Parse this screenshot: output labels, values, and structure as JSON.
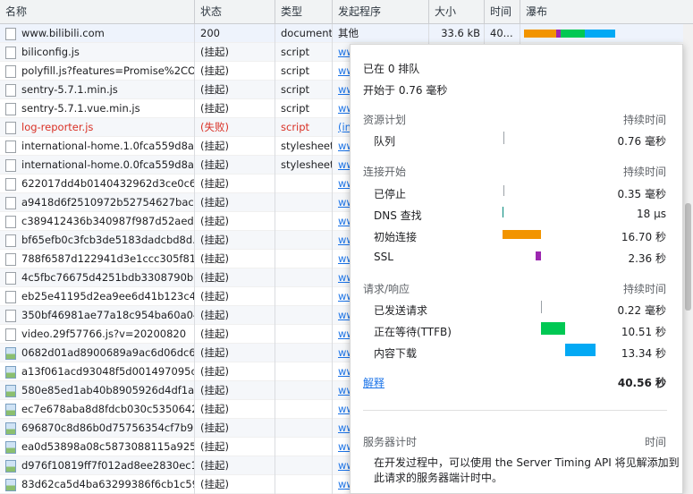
{
  "headers": {
    "name": "名称",
    "status": "状态",
    "type": "类型",
    "initiator": "发起程序",
    "size": "大小",
    "time": "时间",
    "waterfall": "瀑布"
  },
  "rows": [
    {
      "name": "www.bilibili.com",
      "status": "200",
      "type": "document",
      "initiator": "其他",
      "size": "33.6 kB",
      "time": "40...",
      "icon": "file"
    },
    {
      "name": "biliconfig.js",
      "status": "(挂起)",
      "type": "script",
      "initiator": "ww",
      "icon": "file"
    },
    {
      "name": "polyfill.js?features=Promise%2CO...",
      "status": "(挂起)",
      "type": "script",
      "initiator": "ww",
      "icon": "file"
    },
    {
      "name": "sentry-5.7.1.min.js",
      "status": "(挂起)",
      "type": "script",
      "initiator": "ww",
      "icon": "file"
    },
    {
      "name": "sentry-5.7.1.vue.min.js",
      "status": "(挂起)",
      "type": "script",
      "initiator": "ww",
      "icon": "file"
    },
    {
      "name": "log-reporter.js",
      "status": "(失败)",
      "type": "script",
      "initiator": "(in",
      "icon": "file",
      "failed": true
    },
    {
      "name": "international-home.1.0fca559d8a...",
      "status": "(挂起)",
      "type": "stylesheet",
      "initiator": "ww",
      "icon": "file"
    },
    {
      "name": "international-home.0.0fca559d8a...",
      "status": "(挂起)",
      "type": "stylesheet",
      "initiator": "ww",
      "icon": "file"
    },
    {
      "name": "622017dd4b0140432962d3ce0c6...",
      "status": "(挂起)",
      "type": "",
      "initiator": "ww",
      "icon": "file"
    },
    {
      "name": "a9418d6f2510972b52754627bac9...",
      "status": "(挂起)",
      "type": "",
      "initiator": "ww",
      "icon": "file"
    },
    {
      "name": "c389412436b340987f987d52aed9...",
      "status": "(挂起)",
      "type": "",
      "initiator": "ww",
      "icon": "file"
    },
    {
      "name": "bf65efb0c3fcb3de5183dadcbd8d...",
      "status": "(挂起)",
      "type": "",
      "initiator": "ww",
      "icon": "file"
    },
    {
      "name": "788f6587d122941d3e1ccc305f81...",
      "status": "(挂起)",
      "type": "",
      "initiator": "ww",
      "icon": "file"
    },
    {
      "name": "4c5fbc76675d4251bdb3308790b...",
      "status": "(挂起)",
      "type": "",
      "initiator": "ww",
      "icon": "file"
    },
    {
      "name": "eb25e41195d2ea9ee6d41b123c4...",
      "status": "(挂起)",
      "type": "",
      "initiator": "ww",
      "icon": "file"
    },
    {
      "name": "350bf46981ae77a18c954ba60a04...",
      "status": "(挂起)",
      "type": "",
      "initiator": "ww",
      "icon": "file"
    },
    {
      "name": "video.29f57766.js?v=20200820",
      "status": "(挂起)",
      "type": "",
      "initiator": "ww",
      "icon": "file"
    },
    {
      "name": "0682d01ad8900689a9ac6d06dc6...",
      "status": "(挂起)",
      "type": "",
      "initiator": "ww",
      "icon": "img"
    },
    {
      "name": "a13f061acd93048f5d001497095c...",
      "status": "(挂起)",
      "type": "",
      "initiator": "ww",
      "icon": "img"
    },
    {
      "name": "580e85ed1ab40b8905926d4df1a...",
      "status": "(挂起)",
      "type": "",
      "initiator": "ww",
      "icon": "img"
    },
    {
      "name": "ec7e678aba8d8fdcb030c5350642...",
      "status": "(挂起)",
      "type": "",
      "initiator": "ww",
      "icon": "img"
    },
    {
      "name": "696870c8d86b0d75756354cf7b9...",
      "status": "(挂起)",
      "type": "",
      "initiator": "ww",
      "icon": "img"
    },
    {
      "name": "ea0d53898a08c5873088115a925...",
      "status": "(挂起)",
      "type": "",
      "initiator": "ww",
      "icon": "img"
    },
    {
      "name": "d976f10819ff7f012ad8ee2830ec1...",
      "status": "(挂起)",
      "type": "",
      "initiator": "ww",
      "icon": "img"
    },
    {
      "name": "83d62ca5d4ba63299386f6cb1c59...",
      "status": "(挂起)",
      "type": "",
      "initiator": "ww",
      "icon": "img"
    }
  ],
  "popover": {
    "queued_at": "已在 0 排队",
    "started_at": "开始于 0.76 毫秒",
    "resource_scheduling": "资源计划",
    "duration": "持续时间",
    "queueing": "队列",
    "queueing_val": "0.76 毫秒",
    "connection_start": "连接开始",
    "stalled": "已停止",
    "stalled_val": "0.35 毫秒",
    "dns": "DNS 查找",
    "dns_val": "18 µs",
    "initial_connection": "初始连接",
    "initial_connection_val": "16.70 秒",
    "ssl": "SSL",
    "ssl_val": "2.36 秒",
    "request_response": "请求/响应",
    "request_sent": "已发送请求",
    "request_sent_val": "0.22 毫秒",
    "waiting": "正在等待(TTFB)",
    "waiting_val": "10.51 秒",
    "content_download": "内容下载",
    "content_download_val": "13.34 秒",
    "explanation": "解释",
    "total": "40.56 秒",
    "server_timing": "服务器计时",
    "time": "时间",
    "server_note_1": "在开发过程中，可以使用 the Server Timing API 将见解添加到",
    "server_note_2": "此请求的服务器端计时中。"
  },
  "colors": {
    "connection": "#f29400",
    "ssl": "#9c27b0",
    "ttfb": "#00c853",
    "download": "#03a9f4",
    "failed": "#d93025"
  }
}
